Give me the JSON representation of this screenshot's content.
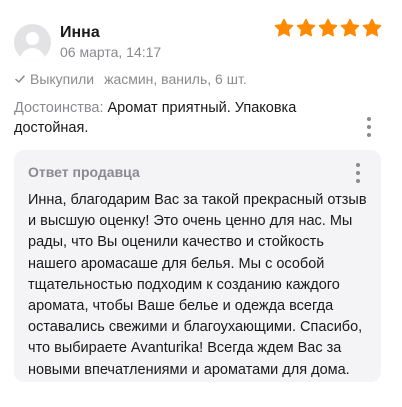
{
  "review": {
    "author": "Инна",
    "date": "06 марта, 14:17",
    "rating": 5,
    "rating_max": 5,
    "star_color": "#ff8a00",
    "purchase_label": "Выкупили",
    "purchase_item": "жасмин, ваниль, 6 шт.",
    "pros_label": "Достоинства:",
    "pros_text": "Аромат приятный. Упаковка достойная."
  },
  "reply": {
    "title": "Ответ продавца",
    "text": "Инна, благодарим Вас за такой прекрасный отзыв и высшую оценку! Это очень ценно для нас. Мы рады, что Вы оценили качество и стойкость нашего аромасаше для белья. Мы с особой тщательностью подходим к созданию каждого аромата, чтобы Ваше белье и одежда всегда оставались свежими и благоухающими. Спасибо, что выбираете Avanturika! Всегда ждем Вас за новыми впечатлениями и ароматами для дома."
  },
  "icons": {
    "avatar": "user-avatar-placeholder",
    "star": "star-icon",
    "check": "check-icon",
    "menu": "more-vertical-icon"
  },
  "colors": {
    "muted_text": "#8a8a8f",
    "reply_background": "#f4f4f6",
    "avatar_background": "#e3e3e6"
  }
}
